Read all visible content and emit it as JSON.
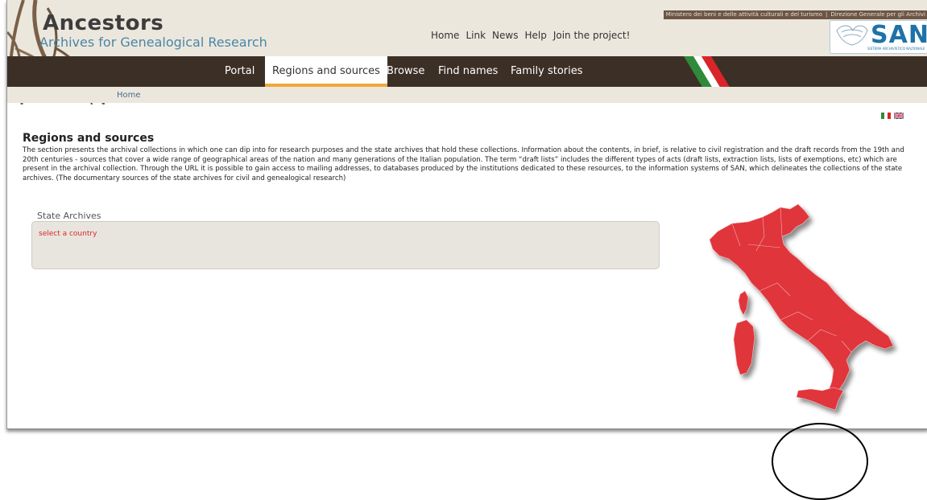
{
  "header": {
    "title": "Ancestors",
    "subtitle": "Archives for Genealogical Research",
    "ministry": "Ministero dei beni e delle attività culturali e del turismo",
    "separator": "|",
    "directorate": "Direzione Generale per gli Archivi",
    "san_logo": "SAN",
    "san_caption": "SISTEMA ARCHIVISTICO NAZIONALE"
  },
  "top_nav": [
    "Home",
    "Link",
    "News",
    "Help",
    "Join the project!"
  ],
  "main_nav": {
    "items": [
      "Portal",
      "Regions and sources",
      "Browse",
      "Find names",
      "Family stories"
    ],
    "active": "Regions and sources"
  },
  "breadcrumb": {
    "home": "Home"
  },
  "colors": {
    "nav_bg": "#3c2f26",
    "accent": "#f0a73a",
    "map_red": "#e0343b",
    "link_blue": "#4a86a7"
  },
  "page": {
    "title": "Regions and sources",
    "intro": "The section presents the archival collections in which one can dip into for research purposes and the state archives that hold these collections. Information about the contents, in brief, is relative to civil registration and the draft records from the 19th and 20th centuries - sources that cover a wide range of geographical areas of the nation and many generations of the Italian population. The term “draft lists” includes the different types of acts (draft lists, extraction lists, lists of exemptions, etc) which are present in the archival collection. Through the URL it is possible to gain access to mailing addresses, to databases produced by the institutions dedicated to these resources, to the information systems of SAN, which delineates the collections of the state archives. (The documentary sources of the state archives for civil and genealogical research)"
  },
  "state_archives": {
    "label": "State Archives",
    "prompt": "select a country"
  },
  "icons": [
    "italian-flag-icon",
    "uk-flag-icon",
    "italy-map-icon",
    "san-logo-icon",
    "roots-decoration-icon"
  ]
}
